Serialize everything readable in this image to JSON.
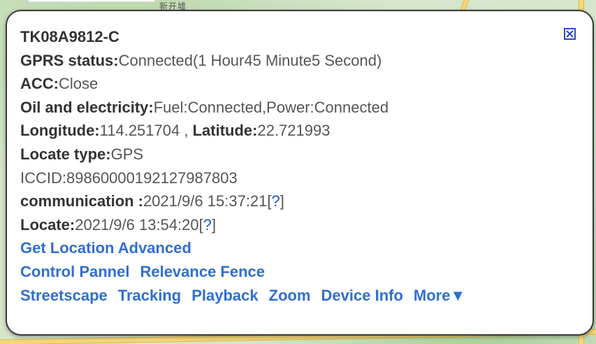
{
  "map": {
    "label": "新开墟"
  },
  "device": {
    "id": "TK08A9812-C",
    "gprs_label": "GPRS status:",
    "gprs_value": "Connected(1 Hour45 Minute5 Second)",
    "acc_label": "ACC:",
    "acc_value": "Close",
    "oil_label": "Oil and electricity:",
    "oil_value": "Fuel:Connected,Power:Connected",
    "lon_label": "Longitude:",
    "lon_value": "114.251704 , ",
    "lat_label": "Latitude:",
    "lat_value": "22.721993",
    "locate_type_label": "Locate type:",
    "locate_type_value": "GPS",
    "iccid": "ICCID:89860000192127987803",
    "comm_label": "communication :",
    "comm_value": "2021/9/6 15:37:21",
    "locate_label": "Locate:",
    "locate_value": "2021/9/6 13:54:20",
    "help_open": "[",
    "help_mark": "?",
    "help_close": "]"
  },
  "actions": {
    "get_location": "Get Location Advanced",
    "control_panel": "Control Pannel",
    "relevance_fence": "Relevance Fence",
    "streetscape": "Streetscape",
    "tracking": "Tracking",
    "playback": "Playback",
    "zoom": "Zoom",
    "device_info": "Device Info",
    "more": "More▼"
  },
  "icons": {
    "close": "close-icon"
  },
  "colors": {
    "link": "#2f6fd0",
    "close_border": "#2b4ac9",
    "label": "#333333",
    "value": "#555555"
  }
}
